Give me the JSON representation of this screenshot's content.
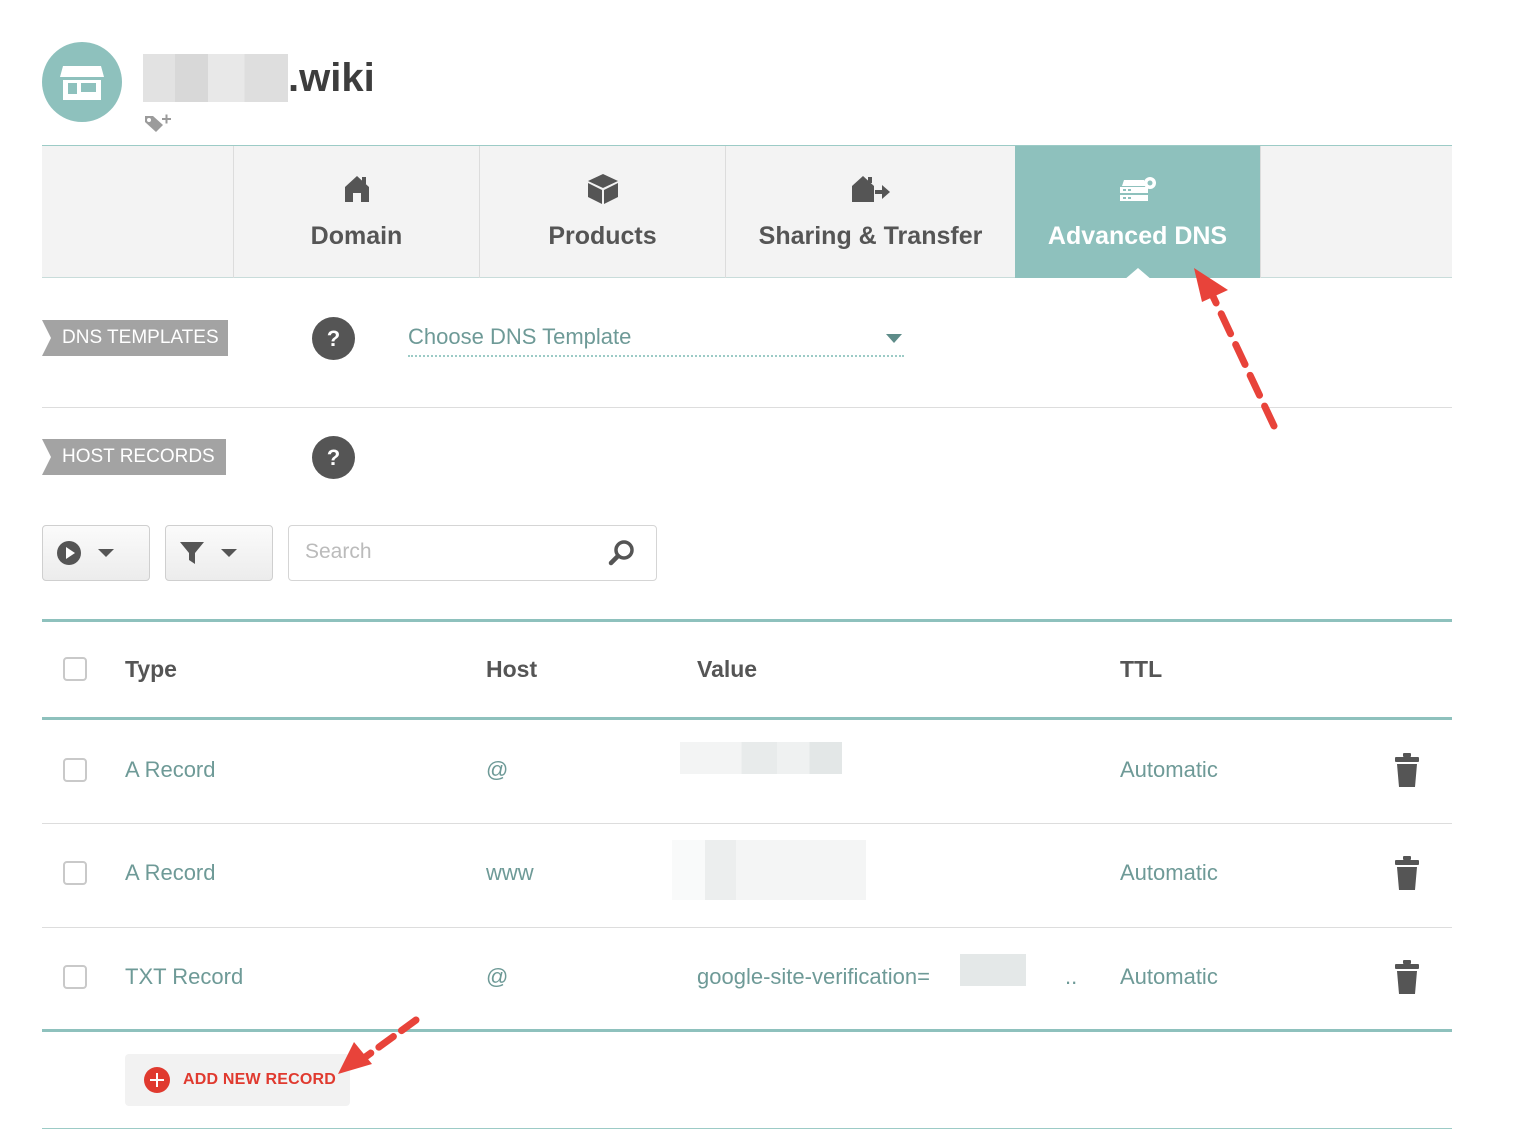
{
  "header": {
    "domain_suffix": ".wiki",
    "avatar_icon": "storefront-icon",
    "tag_icon": "add-tag-icon"
  },
  "tabs": [
    {
      "label": "Domain",
      "icon": "house-icon",
      "active": false
    },
    {
      "label": "Products",
      "icon": "box-icon",
      "active": false
    },
    {
      "label": "Sharing & Transfer",
      "icon": "house-transfer-icon",
      "active": false
    },
    {
      "label": "Advanced DNS",
      "icon": "dns-server-icon",
      "active": true
    }
  ],
  "dns_templates": {
    "section_label": "DNS TEMPLATES",
    "help": "?",
    "select_value": "Choose DNS Template"
  },
  "host_records": {
    "section_label": "HOST RECORDS",
    "help": "?",
    "search_placeholder": "Search"
  },
  "table": {
    "headers": {
      "type": "Type",
      "host": "Host",
      "value": "Value",
      "ttl": "TTL"
    },
    "rows": [
      {
        "type": "A Record",
        "host": "@",
        "value": "",
        "ttl": "Automatic"
      },
      {
        "type": "A Record",
        "host": "www",
        "value": "",
        "ttl": "Automatic"
      },
      {
        "type": "TXT Record",
        "host": "@",
        "value": "google-site-verification=",
        "value_suffix": "..",
        "ttl": "Automatic"
      }
    ]
  },
  "add_record": {
    "label": "ADD NEW RECORD"
  },
  "colors": {
    "accent": "#8ec1bd",
    "link_text": "#6e9a97",
    "danger": "#e03a2f",
    "annotation_arrow": "#e8433a"
  }
}
